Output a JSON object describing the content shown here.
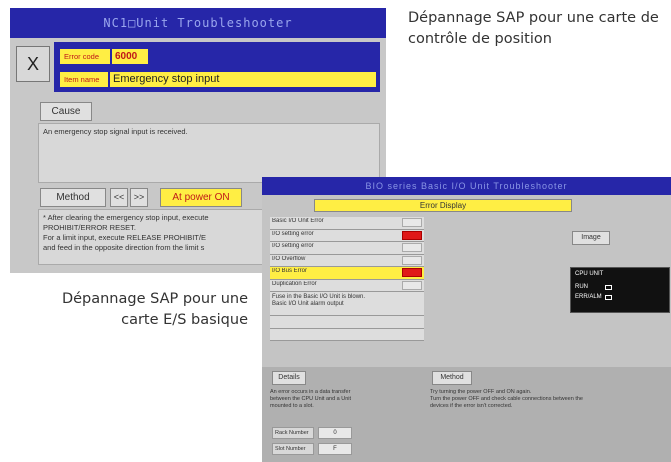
{
  "captions": {
    "top_right": "Dépannage SAP pour une carte de contrôle de position",
    "bottom_left": "Dépannage SAP pour une carte E/S basique"
  },
  "nc_window": {
    "title": "NC1□Unit Troubleshooter",
    "close_label": "X",
    "error_code_label": "Error code",
    "error_code_value": "6000",
    "item_name_label": "Item name",
    "item_name_value": "Emergency stop input",
    "cause_label": "Cause",
    "cause_text": "An emergency stop signal input is received.",
    "method_label": "Method",
    "prev_label": "<<",
    "next_label": ">>",
    "power_label": "At power ON",
    "method_line1": "* After clearing the emergency stop input, execute",
    "method_line2": "PROHIBIT/ERROR RESET.",
    "method_line3": "For a limit input, execute RELEASE PROHIBIT/E",
    "method_line4": "and feed in the opposite direction from the limit s"
  },
  "io_window": {
    "title": "BIO series Basic I/O Unit Troubleshooter",
    "error_display_label": "Error Display",
    "errors": [
      {
        "label": "Basic I/O Unit Error",
        "status": "off"
      },
      {
        "label": "I/O setting error",
        "status": "on"
      },
      {
        "label": "I/O setting error",
        "status": "off"
      },
      {
        "label": "I/O Overflow",
        "status": "off"
      },
      {
        "label": "I/O Bus Error",
        "status": "on",
        "selected": true
      },
      {
        "label": "Duplication Error",
        "status": "off"
      }
    ],
    "note_line1": "Fuse in the Basic I/O Unit is blown.",
    "note_line2": "Basic I/O Unit alarm output",
    "image_label": "Image",
    "cpu_title": "CPU UNIT",
    "cpu_run": "RUN",
    "cpu_alarm": "ERR/ALM",
    "details_label": "Details",
    "details_line1": "An error occurs in a data transfer",
    "details_line2": "between the CPU Unit and a Unit",
    "details_line3": "mounted to a slot.",
    "method_label": "Method",
    "method_line1": "Try turning the power OFF and ON again.",
    "method_line2": "Turn the power OFF and check cable connections between the",
    "method_line3": "devices if the error isn't corrected.",
    "rack_label": "Rack Number",
    "rack_value": "0",
    "slot_label": "Slot Number",
    "slot_value": "F"
  }
}
